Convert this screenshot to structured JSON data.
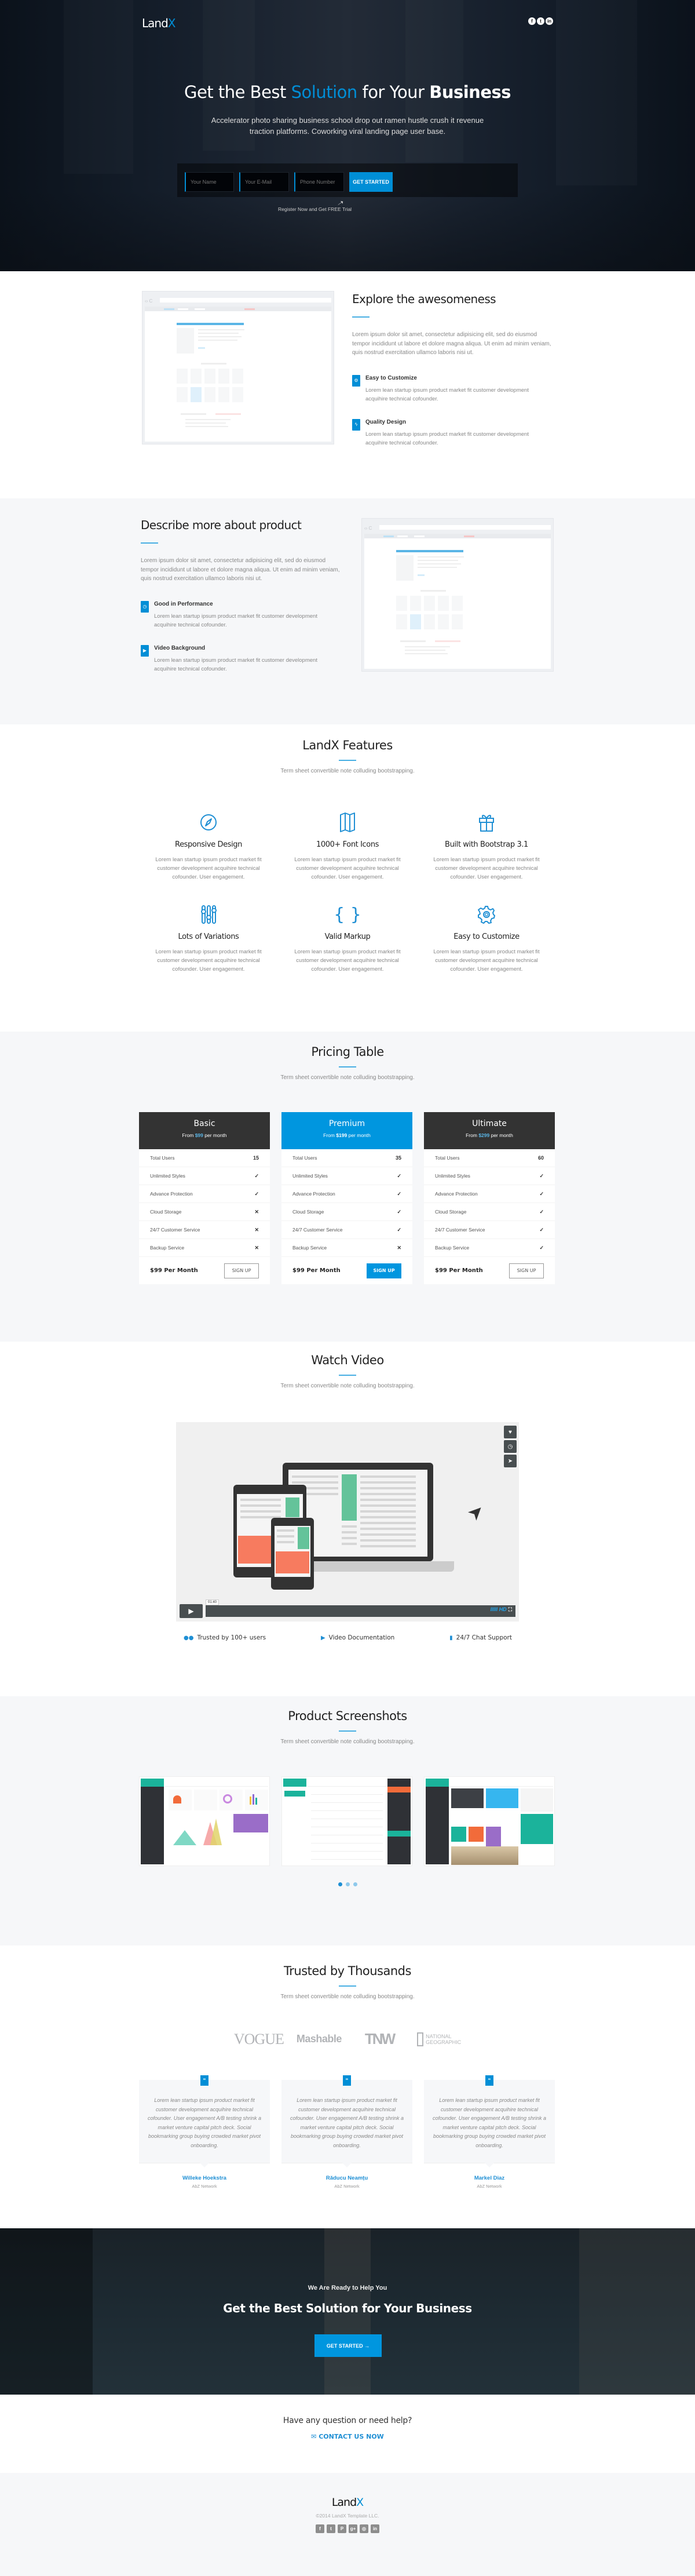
{
  "colors": {
    "accent": "#008ed6",
    "dark": "#333333",
    "light_bg": "#f6f7f9"
  },
  "hero": {
    "logo_main": "Land",
    "logo_accent": "X",
    "socials": [
      {
        "icon": "facebook-icon",
        "glyph": "f"
      },
      {
        "icon": "twitter-icon",
        "glyph": "t"
      },
      {
        "icon": "linkedin-icon",
        "glyph": "in"
      }
    ],
    "title_pre": "Get the Best ",
    "title_accent": "Solution",
    "title_mid": " for Your ",
    "title_bold": "Business",
    "subtitle_line1": "Accelerator photo sharing business school drop out ramen hustle crush it revenue",
    "subtitle_line2": "traction platforms. Coworking viral landing page user base.",
    "form": {
      "name_placeholder": "Your Name",
      "email_placeholder": "Your E-Mail",
      "phone_placeholder": "Phone Number",
      "submit_label": "GET STARTED"
    },
    "register_note": "Register Now and Get FREE Trial",
    "arrow_glyph": "↗"
  },
  "explore": {
    "title": "Explore the awesomeness",
    "paragraph": "Lorem ipsum dolor sit amet, consectetur adipisicing elit, sed do eiusmod tempor incididunt ut labore et dolore magna aliqua. Ut enim ad minim veniam, quis nostrud exercitation ullamco laboris nisi ut.",
    "features": [
      {
        "icon": "gear-icon",
        "glyph": "⚙",
        "title": "Easy to Customize",
        "text": "Lorem lean startup ipsum product market fit customer development acquihire technical cofounder."
      },
      {
        "icon": "lightning-icon",
        "glyph": "ϟ",
        "title": "Quality Design",
        "text": "Lorem lean startup ipsum product market fit customer development acquihire technical cofounder."
      }
    ],
    "mock_nav_glyph": "‹› C",
    "mock_dots": "•••"
  },
  "describe": {
    "title": "Describe more about product",
    "paragraph": "Lorem ipsum dolor sit amet, consectetur adipisicing elit, sed do eiusmod tempor incididunt ut labore et dolore magna aliqua. Ut enim ad minim veniam, quis nostrud exercitation ullamco laboris nisi ut.",
    "features": [
      {
        "icon": "speedometer-icon",
        "glyph": "◷",
        "title": "Good in Performance",
        "text": "Lorem lean startup ipsum product market fit customer development acquihire technical cofounder."
      },
      {
        "icon": "video-icon",
        "glyph": "▶",
        "title": "Video Background",
        "text": "Lorem lean startup ipsum product market fit customer development acquihire technical cofounder."
      }
    ]
  },
  "features": {
    "title": "LandX Features",
    "subtitle": "Term sheet convertible note colluding bootstrapping.",
    "items": [
      {
        "icon": "compass-icon",
        "title": "Responsive Design",
        "text": "Lorem lean startup ipsum product market fit customer development acquihire technical cofounder. User engagement."
      },
      {
        "icon": "map-icon",
        "title": "1000+ Font Icons",
        "text": "Lorem lean startup ipsum product market fit customer development acquihire technical cofounder. User engagement."
      },
      {
        "icon": "gift-icon",
        "title": "Built with Bootstrap 3.1",
        "text": "Lorem lean startup ipsum product market fit customer development acquihire technical cofounder. User engagement."
      },
      {
        "icon": "sliders-icon",
        "title": "Lots of Variations",
        "text": "Lorem lean startup ipsum product market fit customer development acquihire technical cofounder. User engagement."
      },
      {
        "icon": "braces-icon",
        "title": "Valid Markup",
        "text": "Lorem lean startup ipsum product market fit customer development acquihire technical cofounder. User engagement."
      },
      {
        "icon": "gear-icon",
        "title": "Easy to Customize",
        "text": "Lorem lean startup ipsum product market fit customer development acquihire technical cofounder. User engagement."
      }
    ]
  },
  "pricing": {
    "title": "Pricing Table",
    "subtitle": "Term sheet convertible note colluding bootstrapping.",
    "plans": [
      {
        "name": "Basic",
        "from": "From ",
        "amount": "$99",
        "per": " per month",
        "featured": false,
        "rows": [
          {
            "label": "Total Users",
            "value": "15"
          },
          {
            "label": "Unlimited Styles",
            "value": "✓"
          },
          {
            "label": "Advance Protection",
            "value": "✓"
          },
          {
            "label": "Cloud Storage",
            "value": "✕"
          },
          {
            "label": "24/7 Customer Service",
            "value": "✕"
          },
          {
            "label": "Backup Service",
            "value": "✕"
          }
        ],
        "price_label": "$99 Per Month",
        "button": "SIGN UP"
      },
      {
        "name": "Premium",
        "from": "From ",
        "amount": "$199",
        "per": " per month",
        "featured": true,
        "rows": [
          {
            "label": "Total Users",
            "value": "35"
          },
          {
            "label": "Unlimited Styles",
            "value": "✓"
          },
          {
            "label": "Advance Protection",
            "value": "✓"
          },
          {
            "label": "Cloud Storage",
            "value": "✓"
          },
          {
            "label": "24/7 Customer Service",
            "value": "✓"
          },
          {
            "label": "Backup Service",
            "value": "✕"
          }
        ],
        "price_label": "$99 Per Month",
        "button": "SIGN UP"
      },
      {
        "name": "Ultimate",
        "from": "From ",
        "amount": "$299",
        "per": " per month",
        "featured": false,
        "rows": [
          {
            "label": "Total Users",
            "value": "60"
          },
          {
            "label": "Unlimited Styles",
            "value": "✓"
          },
          {
            "label": "Advance Protection",
            "value": "✓"
          },
          {
            "label": "Cloud Storage",
            "value": "✓"
          },
          {
            "label": "24/7 Customer Service",
            "value": "✓"
          },
          {
            "label": "Backup Service",
            "value": "✓"
          }
        ],
        "price_label": "$99 Per Month",
        "button": "SIGN UP"
      }
    ]
  },
  "video": {
    "title": "Watch Video",
    "subtitle": "Term sheet convertible note colluding bootstrapping.",
    "side_icons": [
      {
        "icon": "heart-icon",
        "glyph": "♥"
      },
      {
        "icon": "clock-icon",
        "glyph": "◷"
      },
      {
        "icon": "send-icon",
        "glyph": "➤"
      }
    ],
    "play_glyph": "▶",
    "time": "01:40",
    "volume_glyph": "IIIII",
    "hd_label": "HD",
    "fullscreen_glyph": "⛶",
    "cursor_glyph": "➤",
    "highlights": [
      {
        "icon": "users-icon",
        "glyph": "👥",
        "label": "Trusted by 100+ users"
      },
      {
        "icon": "video-doc-icon",
        "glyph": "▣",
        "label": "Video Documentation"
      },
      {
        "icon": "chat-icon",
        "glyph": "💬",
        "label": "24/7 Chat Support"
      }
    ]
  },
  "screens": {
    "title": "Product Screenshots",
    "subtitle": "Term sheet convertible note colluding bootstrapping.",
    "slides": [
      "dashboard",
      "inbox",
      "profile-widgets"
    ],
    "active_slide": 1,
    "slide_count": 3
  },
  "trusted": {
    "title": "Trusted by Thousands",
    "subtitle": "Term sheet convertible note colluding bootstrapping.",
    "logos": {
      "vogue": "VOGUE",
      "mashable": "Mashable",
      "tnw": "TNW",
      "natgeo_line1": "NATIONAL",
      "natgeo_line2": "GEOGRAPHIC"
    },
    "quote_glyph": "“",
    "testimonials": [
      {
        "text": "Lorem lean startup ipsum product market fit customer development acquihire technical cofounder. User engagement A/B testing shrink a market venture capital pitch deck. Social bookmarking group buying crowded market pivot onboarding.",
        "name": "Willeke Hoekstra",
        "org": "AbZ Network"
      },
      {
        "text": "Lorem lean startup ipsum product market fit customer development acquihire technical cofounder. User engagement A/B testing shrink a market venture capital pitch deck. Social bookmarking group buying crowded market pivot onboarding.",
        "name": "Răducu Neamțu",
        "org": "AbZ Network"
      },
      {
        "text": "Lorem lean startup ipsum product market fit customer development acquihire technical cofounder. User engagement A/B testing shrink a market venture capital pitch deck. Social bookmarking group buying crowded market pivot onboarding.",
        "name": "Markel Diaz",
        "org": "AbZ Network"
      }
    ]
  },
  "cta": {
    "small": "We Are Ready to Help You",
    "big": "Get the Best Solution for Your Business",
    "button": "GET STARTED  →"
  },
  "help": {
    "question": "Have any question or need help?",
    "link_icon": "✉",
    "link_label": "CONTACT US NOW"
  },
  "footer": {
    "logo_main": "Land",
    "logo_accent": "X",
    "copyright": "©2014 LandX Template LLC.",
    "socials": [
      {
        "icon": "facebook-icon",
        "glyph": "f"
      },
      {
        "icon": "twitter-icon",
        "glyph": "t"
      },
      {
        "icon": "pinterest-icon",
        "glyph": "P"
      },
      {
        "icon": "google-plus-icon",
        "glyph": "g+"
      },
      {
        "icon": "instagram-icon",
        "glyph": "◎"
      },
      {
        "icon": "linkedin-icon",
        "glyph": "in"
      }
    ]
  }
}
